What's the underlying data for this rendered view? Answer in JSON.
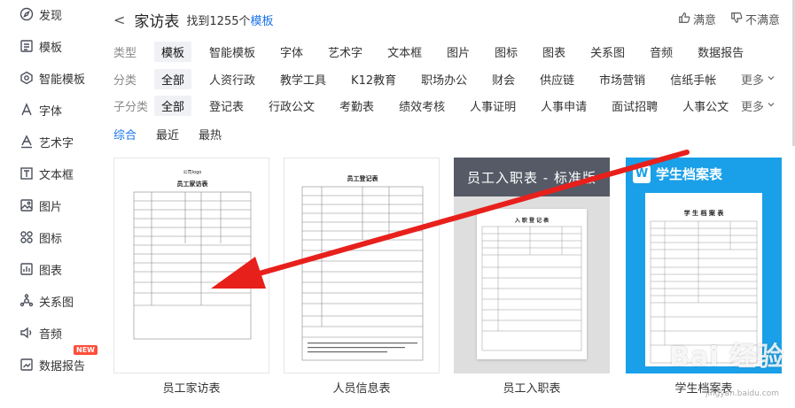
{
  "sidebar": {
    "items": [
      {
        "label": "发现",
        "icon": "compass-icon"
      },
      {
        "label": "模板",
        "icon": "template-icon"
      },
      {
        "label": "智能模板",
        "icon": "smart-template-icon"
      },
      {
        "label": "字体",
        "icon": "font-icon"
      },
      {
        "label": "艺术字",
        "icon": "art-text-icon"
      },
      {
        "label": "文本框",
        "icon": "textbox-icon"
      },
      {
        "label": "图片",
        "icon": "image-icon"
      },
      {
        "label": "图标",
        "icon": "icons-icon"
      },
      {
        "label": "图表",
        "icon": "chart-icon"
      },
      {
        "label": "关系图",
        "icon": "relation-icon"
      },
      {
        "label": "音频",
        "icon": "audio-icon"
      },
      {
        "label": "数据报告",
        "icon": "data-report-icon"
      }
    ],
    "new_badge": "NEW"
  },
  "header": {
    "back": "<",
    "title": "家访表",
    "found_prefix": "找到1255个",
    "found_highlight": "模板",
    "satisfied": "满意",
    "unsatisfied": "不满意"
  },
  "filters": {
    "type": {
      "label": "类型",
      "options": [
        "模板",
        "智能模板",
        "字体",
        "艺术字",
        "文本框",
        "图片",
        "图标",
        "图表",
        "关系图",
        "音频",
        "数据报告"
      ]
    },
    "category": {
      "label": "分类",
      "options": [
        "全部",
        "人资行政",
        "教学工具",
        "K12教育",
        "职场办公",
        "财会",
        "供应链",
        "市场营销",
        "信纸手帐"
      ]
    },
    "subcategory": {
      "label": "子分类",
      "options": [
        "全部",
        "登记表",
        "行政公文",
        "考勤表",
        "绩效考核",
        "人事证明",
        "人事申请",
        "面试招聘",
        "人事公文"
      ]
    },
    "more": "更多"
  },
  "sort": {
    "options": [
      "综合",
      "最近",
      "最热"
    ]
  },
  "cards": [
    {
      "name": "员工家访表",
      "doc_title": "员工家访表",
      "doc_logo": "公司logo"
    },
    {
      "name": "人员信息表",
      "doc_title": "员工登记表"
    },
    {
      "name": "员工入职表",
      "banner": "员工入职表 - 标准版",
      "doc_title": "入 职 登 记 表"
    },
    {
      "name": "学生档案表",
      "banner": "学生档案表",
      "doc_title": "学 生 档 案 表",
      "logo_letter": "W"
    }
  ],
  "watermark": {
    "text": "Bai 经验",
    "sub": "jingyan.baidu.com"
  },
  "colors": {
    "accent": "#1a73e8",
    "arrow": "#e8201c",
    "banner_gray": "#555a66",
    "banner_blue": "#1aa0e8"
  }
}
